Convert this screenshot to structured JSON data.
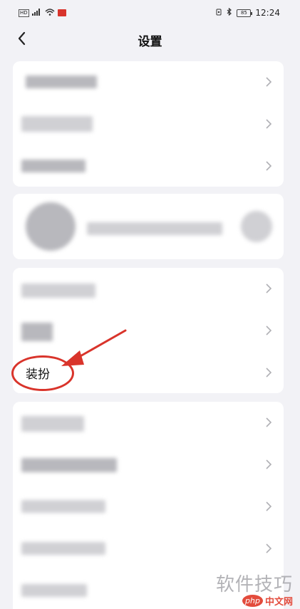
{
  "status_bar": {
    "signal_badge": "HD",
    "time": "12:24",
    "battery": "85"
  },
  "header": {
    "title": "设置"
  },
  "list": {
    "highlighted_item_label": "装扮"
  },
  "annotation": {
    "color": "#d9342b"
  },
  "watermark": {
    "text": "软件技巧",
    "badge_php": "php",
    "badge_cn": "中文网"
  }
}
